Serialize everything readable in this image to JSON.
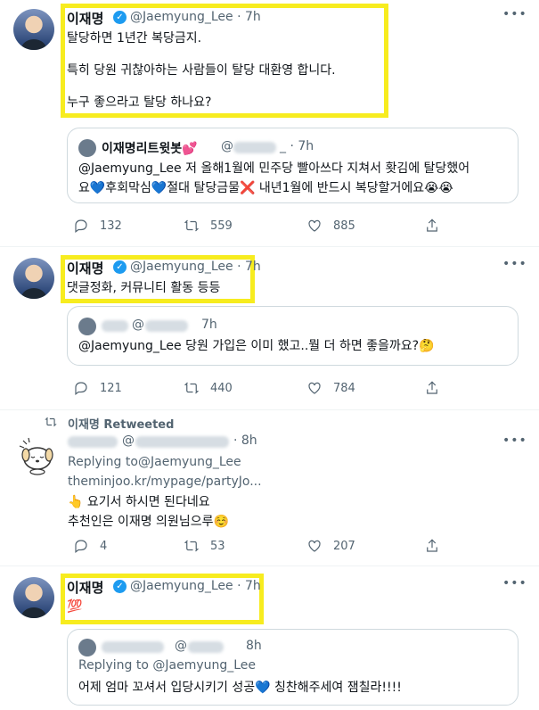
{
  "tweets": [
    {
      "name": "이재명",
      "handle": "@Jaemyung_Lee · 7h",
      "text": "탈당하면 1년간 복당금지.\n\n특히 당원 귀찮아하는 사람들이 탈당 대환영 합니다.\n\n누구 좋으라고 탈당 하나요?",
      "quote": {
        "name": "이재명리트윗봇💕",
        "handle_prefix": "@",
        "handle_suffix": "_ · 7h",
        "text": "@Jaemyung_Lee 저 올해1월에 민주당 빨아쓰다 지쳐서 홧김에 탈당했어\n요💙후회막심💙절대 탈당금물❌ 내년1월에 반드시 복당할거에요😭😭"
      },
      "replies": "132",
      "retweets": "559",
      "likes": "885"
    },
    {
      "name": "이재명",
      "handle": "@Jaemyung_Lee · 7h",
      "text": "댓글정화, 커뮤니티 활동 등등",
      "quote": {
        "handle_prefix": "@",
        "handle_suffix": "7h",
        "text": "@Jaemyung_Lee 당원 가입은 이미 했고..뭘 더 하면 좋을까요?🤔"
      },
      "replies": "121",
      "retweets": "440",
      "likes": "784"
    },
    {
      "retweeted_label": "이재명 Retweeted",
      "handle_prefix": "@",
      "handle_suffix": "· 8h",
      "replying_label": "Replying to ",
      "replying_handle": "@Jaemyung_Lee",
      "link": "theminjoo.kr/mypage/partyJo...",
      "text": "👆 요기서 하시면 된다네요\n추천인은 이재명 의원님으루☺️",
      "replies": "4",
      "retweets": "53",
      "likes": "207"
    },
    {
      "name": "이재명",
      "handle": "@Jaemyung_Lee · 7h",
      "text": "💯",
      "quote": {
        "handle_prefix": "@",
        "handle_suffix": "8h",
        "replying": "Replying to @Jaemyung_Lee",
        "text": "어제 엄마 꼬셔서 입당시키기 성공💙 칭찬해주세여 잼칠라!!!!"
      }
    }
  ],
  "colors": {
    "highlight": "#f7ec1f",
    "verified": "#1d9bf0",
    "secondary": "#536471"
  }
}
